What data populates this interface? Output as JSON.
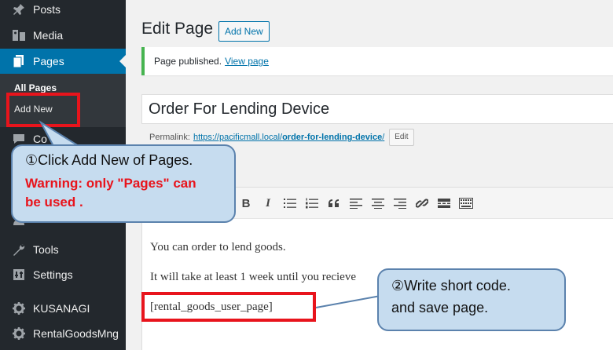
{
  "sidebar": {
    "items": [
      {
        "label": "Posts",
        "icon": "pin-icon"
      },
      {
        "label": "Media",
        "icon": "media-icon"
      },
      {
        "label": "Pages",
        "icon": "pages-icon"
      },
      {
        "label": "Co",
        "icon": "comments-icon"
      },
      {
        "label": "Users",
        "icon": "users-icon"
      },
      {
        "label": "Tools",
        "icon": "wrench-icon"
      },
      {
        "label": "Settings",
        "icon": "settings-icon"
      },
      {
        "label": "KUSANAGI",
        "icon": "gear-icon"
      },
      {
        "label": "RentalGoodsMng",
        "icon": "gear-icon"
      }
    ],
    "submenu": {
      "all_pages": "All Pages",
      "add_new": "Add New"
    },
    "colors": {
      "background": "#23282d",
      "active": "#0073aa"
    }
  },
  "main": {
    "title": "Edit Page",
    "add_new_label": "Add New",
    "notice": {
      "text": "Page published.",
      "link": "View page"
    },
    "page_title_value": "Order For Lending Device",
    "permalink": {
      "label": "Permalink:",
      "url_base": "https://pacificmall.local/",
      "slug": "order-for-lending-device",
      "trailing": "/",
      "edit_label": "Edit"
    },
    "editor": {
      "paragraphs": [
        "You can order to lend goods.",
        "It will take at least 1 week until you recieve",
        "[rental_goods_user_page]"
      ]
    }
  },
  "annotations": {
    "callout1": {
      "line1": "①Click Add New of Pages.",
      "warning1": "Warning: only \"Pages\" can",
      "warning2": "be used ."
    },
    "callout2": {
      "line1": "②Write short code.",
      "line2": "and save page."
    },
    "colors": {
      "highlight": "#e8141c",
      "callout_fill": "#c6dcef",
      "callout_border": "#5b82ad"
    }
  }
}
